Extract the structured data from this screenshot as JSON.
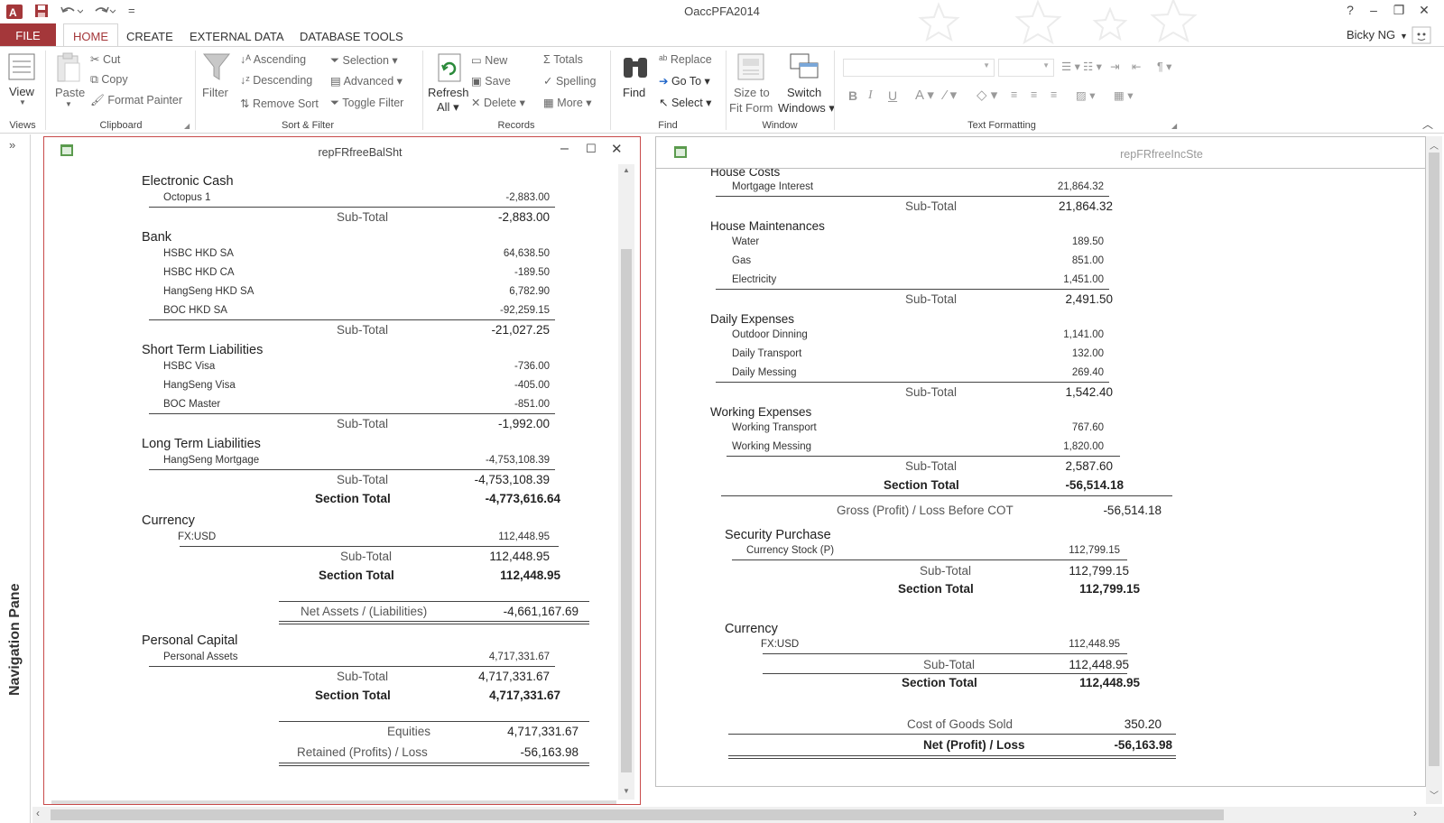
{
  "app": {
    "title": "OaccPFA2014",
    "user": "Bicky NG",
    "help": "?",
    "win_min": "–",
    "win_restore": "❐",
    "win_close": "✕",
    "qat_more": "="
  },
  "tabs": {
    "file": "FILE",
    "home": "HOME",
    "create": "CREATE",
    "external": "EXTERNAL DATA",
    "dbtools": "DATABASE TOOLS"
  },
  "ribbon": {
    "views": {
      "view": "View",
      "label": "Views"
    },
    "clipboard": {
      "paste": "Paste",
      "cut": "Cut",
      "copy": "Copy",
      "format_painter": "Format Painter",
      "label": "Clipboard"
    },
    "sortfilter": {
      "filter": "Filter",
      "ascending": "Ascending",
      "descending": "Descending",
      "remove_sort": "Remove Sort",
      "selection": "Selection",
      "advanced": "Advanced",
      "toggle_filter": "Toggle Filter",
      "label": "Sort & Filter"
    },
    "records": {
      "refresh1": "Refresh",
      "refresh2": "All",
      "new": "New",
      "save": "Save",
      "delete": "Delete",
      "totals": "Totals",
      "spelling": "Spelling",
      "more": "More",
      "label": "Records"
    },
    "find": {
      "find": "Find",
      "replace": "Replace",
      "goto": "Go To",
      "select": "Select",
      "label": "Find"
    },
    "window": {
      "size1": "Size to",
      "size2": "Fit Form",
      "switch1": "Switch",
      "switch2": "Windows",
      "label": "Window"
    },
    "textfmt": {
      "bold": "B",
      "italic": "I",
      "underline": "U",
      "fontcolor": "A",
      "label": "Text Formatting"
    }
  },
  "nav": {
    "label": "Navigation Pane",
    "toggle": "»"
  },
  "balsheet": {
    "title": "repFRfreeBalSht",
    "sections": [
      {
        "name": "Electronic Cash",
        "items": [
          {
            "label": "Octopus 1",
            "value": "-2,883.00"
          }
        ],
        "subtotal_label": "Sub-Total",
        "subtotal": "-2,883.00"
      },
      {
        "name": "Bank",
        "items": [
          {
            "label": "HSBC HKD SA",
            "value": "64,638.50"
          },
          {
            "label": "HSBC HKD CA",
            "value": "-189.50"
          },
          {
            "label": "HangSeng HKD SA",
            "value": "6,782.90"
          },
          {
            "label": "BOC HKD SA",
            "value": "-92,259.15"
          }
        ],
        "subtotal_label": "Sub-Total",
        "subtotal": "-21,027.25"
      },
      {
        "name": "Short Term Liabilities",
        "items": [
          {
            "label": "HSBC Visa",
            "value": "-736.00"
          },
          {
            "label": "HangSeng Visa",
            "value": "-405.00"
          },
          {
            "label": "BOC Master",
            "value": "-851.00"
          }
        ],
        "subtotal_label": "Sub-Total",
        "subtotal": "-1,992.00"
      },
      {
        "name": "Long Term Liabilities",
        "items": [
          {
            "label": "HangSeng Mortgage",
            "value": "-4,753,108.39"
          }
        ],
        "subtotal_label": "Sub-Total",
        "subtotal": "-4,753,108.39",
        "section_total_label": "Section Total",
        "section_total": "-4,773,616.64"
      },
      {
        "name": "Currency",
        "items": [
          {
            "label": "FX:USD",
            "value": "112,448.95"
          }
        ],
        "subtotal_label": "Sub-Total",
        "subtotal": "112,448.95",
        "section_total_label": "Section Total",
        "section_total": "112,448.95"
      }
    ],
    "net_assets_label": "Net Assets / (Liabilities)",
    "net_assets": "-4,661,167.69",
    "capital": {
      "name": "Personal Capital",
      "item_label": "Personal Assets",
      "item_value": "4,717,331.67",
      "subtotal_label": "Sub-Total",
      "subtotal": "4,717,331.67",
      "section_total_label": "Section Total",
      "section_total": "4,717,331.67"
    },
    "equities_label": "Equities",
    "equities": "4,717,331.67",
    "retained_label": "Retained (Profits) / Loss",
    "retained": "-56,163.98"
  },
  "incstmt": {
    "title": "repFRfreeIncSte",
    "house_costs": {
      "name": "House Costs",
      "items": [
        {
          "label": "Mortgage Interest",
          "value": "21,864.32"
        }
      ],
      "subtotal_label": "Sub-Total",
      "subtotal": "21,864.32"
    },
    "house_maint": {
      "name": "House Maintenances",
      "items": [
        {
          "label": "Water",
          "value": "189.50"
        },
        {
          "label": "Gas",
          "value": "851.00"
        },
        {
          "label": "Electricity",
          "value": "1,451.00"
        }
      ],
      "subtotal_label": "Sub-Total",
      "subtotal": "2,491.50"
    },
    "daily": {
      "name": "Daily Expenses",
      "items": [
        {
          "label": "Outdoor Dinning",
          "value": "1,141.00"
        },
        {
          "label": "Daily Transport",
          "value": "132.00"
        },
        {
          "label": "Daily Messing",
          "value": "269.40"
        }
      ],
      "subtotal_label": "Sub-Total",
      "subtotal": "1,542.40"
    },
    "working": {
      "name": "Working Expenses",
      "items": [
        {
          "label": "Working Transport",
          "value": "767.60"
        },
        {
          "label": "Working Messing",
          "value": "1,820.00"
        }
      ],
      "subtotal_label": "Sub-Total",
      "subtotal": "2,587.60",
      "section_total_label": "Section Total",
      "section_total": "-56,514.18"
    },
    "gross_label": "Gross (Profit) / Loss Before COT",
    "gross": "-56,514.18",
    "security": {
      "name": "Security Purchase",
      "item_label": "Currency Stock (P)",
      "item_value": "112,799.15",
      "subtotal_label": "Sub-Total",
      "subtotal": "112,799.15",
      "section_total_label": "Section Total",
      "section_total": "112,799.15"
    },
    "currency": {
      "name": "Currency",
      "item_label": "FX:USD",
      "item_value": "112,448.95",
      "subtotal_label": "Sub-Total",
      "subtotal": "112,448.95",
      "section_total_label": "Section Total",
      "section_total": "112,448.95"
    },
    "cogs_label": "Cost of Goods Sold",
    "cogs": "350.20",
    "net_label": "Net (Profit) / Loss",
    "net": "-56,163.98"
  }
}
